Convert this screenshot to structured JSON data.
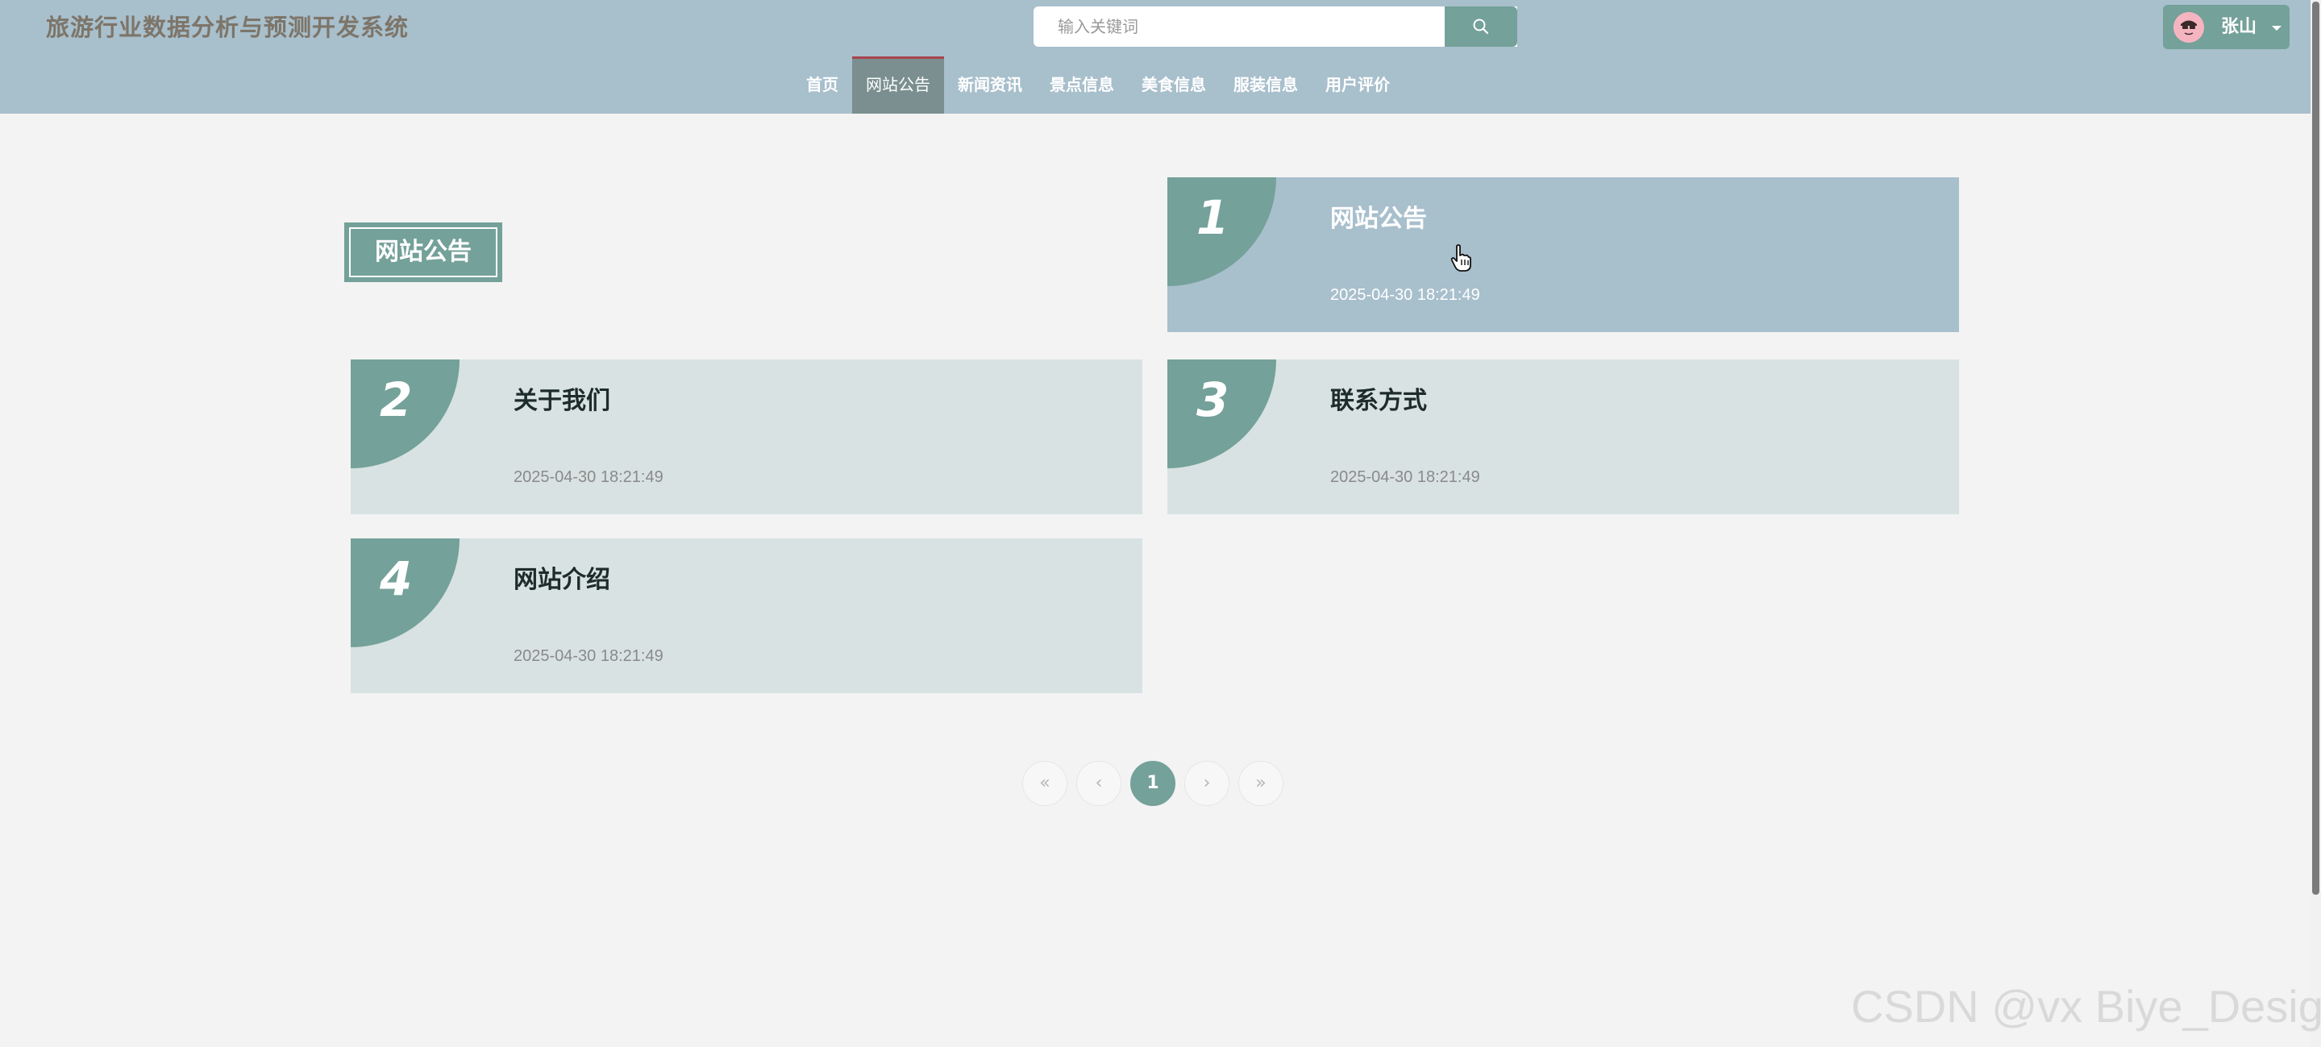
{
  "header": {
    "site_title": "旅游行业数据分析与预测开发系统",
    "search_placeholder": "输入关键词",
    "search_icon": "search-icon",
    "user_name": "张山",
    "avatar_icon": "avatar-icon",
    "caret_icon": "caret-down-icon"
  },
  "nav": {
    "items": [
      {
        "label": "首页",
        "active": false
      },
      {
        "label": "网站公告",
        "active": true
      },
      {
        "label": "新闻资讯",
        "active": false
      },
      {
        "label": "景点信息",
        "active": false
      },
      {
        "label": "美食信息",
        "active": false
      },
      {
        "label": "服装信息",
        "active": false
      },
      {
        "label": "用户评价",
        "active": false
      }
    ]
  },
  "section": {
    "heading": "网站公告"
  },
  "notices": [
    {
      "num": "1",
      "title": "网站公告",
      "date": "2025-04-30 18:21:49"
    },
    {
      "num": "2",
      "title": "关于我们",
      "date": "2025-04-30 18:21:49"
    },
    {
      "num": "3",
      "title": "联系方式",
      "date": "2025-04-30 18:21:49"
    },
    {
      "num": "4",
      "title": "网站介绍",
      "date": "2025-04-30 18:21:49"
    }
  ],
  "pagination": {
    "first": "«",
    "prev": "‹",
    "current": "1",
    "next": "›",
    "last": "»"
  },
  "watermark": "CSDN @vx Biye_Design",
  "colors": {
    "header_bg": "#a8bfcc",
    "accent": "#74a199",
    "card_bg": "#d8e2e2",
    "page_bg": "#f3f3f3"
  }
}
